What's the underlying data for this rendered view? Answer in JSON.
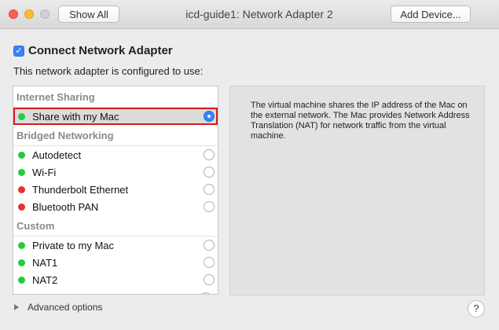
{
  "window": {
    "title": "icd-guide1: Network Adapter 2",
    "show_all_label": "Show All",
    "add_device_label": "Add Device..."
  },
  "connect": {
    "checked": true,
    "label": "Connect Network Adapter"
  },
  "subtitle": "This network adapter is configured to use:",
  "groups": {
    "internet_sharing": "Internet Sharing",
    "bridged": "Bridged Networking",
    "custom": "Custom"
  },
  "items": {
    "share": {
      "label": "Share with my Mac",
      "status": "green",
      "selected": true
    },
    "autodetect": {
      "label": "Autodetect",
      "status": "green",
      "selected": false
    },
    "wifi": {
      "label": "Wi-Fi",
      "status": "green",
      "selected": false
    },
    "thunderbolt": {
      "label": "Thunderbolt Ethernet",
      "status": "red",
      "selected": false
    },
    "bluetooth": {
      "label": "Bluetooth PAN",
      "status": "red",
      "selected": false
    },
    "private": {
      "label": "Private to my Mac",
      "status": "green",
      "selected": false
    },
    "nat1": {
      "label": "NAT1",
      "status": "green",
      "selected": false
    },
    "nat2": {
      "label": "NAT2",
      "status": "green",
      "selected": false
    }
  },
  "description": "The virtual machine shares the IP address of the Mac on the external network. The Mac provides Network Address Translation (NAT) for network traffic from the virtual machine.",
  "advanced_label": "Advanced options",
  "help_label": "?",
  "colors": {
    "status_green": "#28c840",
    "status_red": "#e8312c",
    "accent": "#3a82f7",
    "highlight_outline": "#d71a1a"
  }
}
